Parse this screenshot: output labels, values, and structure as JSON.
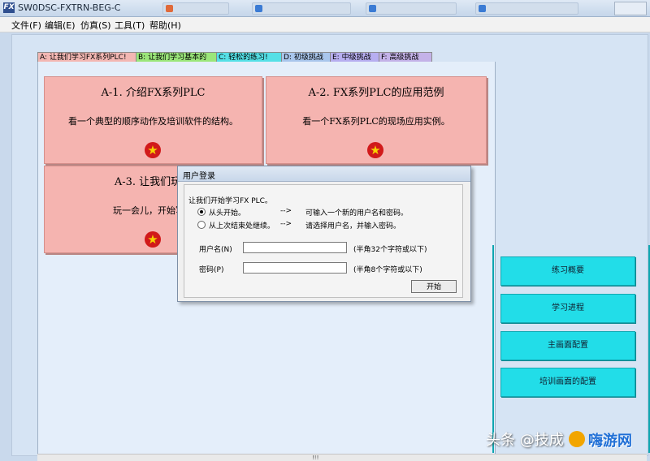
{
  "window": {
    "title": "SW0DSC-FXTRN-BEG-C",
    "icon_label": "FX"
  },
  "menu": [
    {
      "label": "文件(F)"
    },
    {
      "label": "编辑(E)"
    },
    {
      "label": "仿真(S)"
    },
    {
      "label": "工具(T)"
    },
    {
      "label": "帮助(H)"
    }
  ],
  "tabs": [
    {
      "label": "A: 让我们学习FX系列PLC!",
      "color": "#f3b7b3"
    },
    {
      "label": "B: 让我们学习基本的",
      "color": "#9be67a"
    },
    {
      "label": "C: 轻松的练习!",
      "color": "#55e0e6"
    },
    {
      "label": "D: 初级挑战",
      "color": "#a9c6ec"
    },
    {
      "label": "E: 中级挑战",
      "color": "#b7aef0"
    },
    {
      "label": "F: 高级挑战",
      "color": "#c4b2e8"
    }
  ],
  "cards": [
    {
      "title": "A-1. 介绍FX系列PLC",
      "desc": "看一个典型的顺序动作及培训软件的结构。"
    },
    {
      "title": "A-2. FX系列PLC的应用范例",
      "desc": "看一个FX系列PLC的现场应用实例。"
    },
    {
      "title": "A-3. 让我们玩一",
      "desc": "玩一会儿，开始写一"
    }
  ],
  "star_icon": "★",
  "dialog": {
    "title": "用户登录",
    "prompt": "让我们开始学习FX PLC。",
    "option1_label": "从头开始。",
    "option1_arrow": "-->",
    "option1_hint": "可输入一个新的用户名和密码。",
    "option2_label": "从上次结束处继续。",
    "option2_arrow": "-->",
    "option2_hint": "请选择用户名，并输入密码。",
    "username_label": "用户名(N)",
    "username_value": "",
    "username_hint": "(半角32个字符或以下)",
    "password_label": "密码(P)",
    "password_value": "",
    "password_hint": "(半角8个字符或以下)",
    "start_button": "开始"
  },
  "sidebar_buttons": [
    {
      "label": "练习概要"
    },
    {
      "label": "学习进程"
    },
    {
      "label": "主画面配置"
    },
    {
      "label": "培训画面的配置"
    }
  ],
  "scrollbar_grip": "!!!",
  "watermark": {
    "text": "头条 @技成",
    "brand": "嗨游网"
  }
}
